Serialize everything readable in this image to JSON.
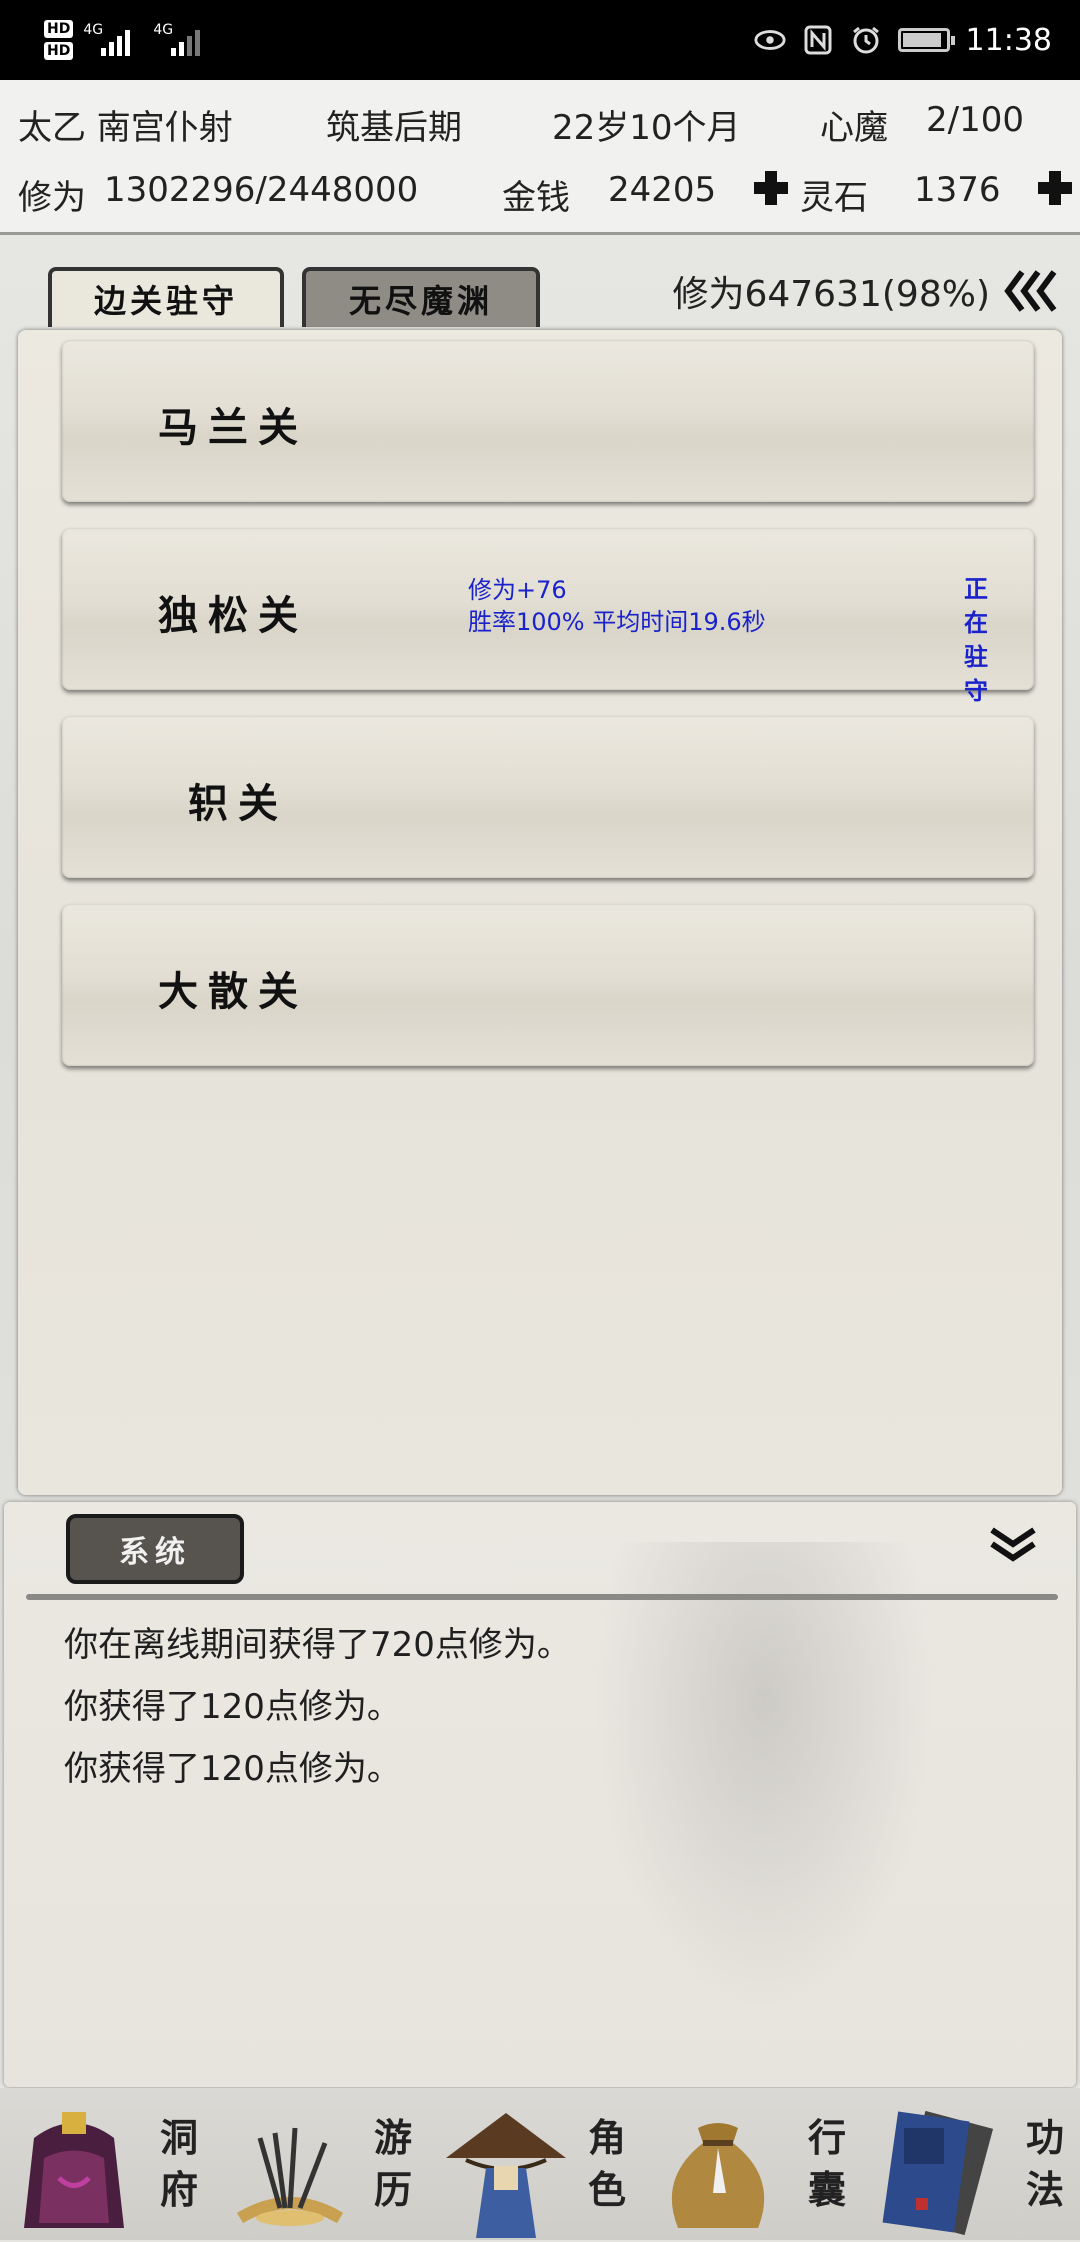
{
  "status_bar": {
    "time": "11:38",
    "sim_labels": [
      "HD",
      "HD"
    ],
    "network": [
      "4G",
      "4G"
    ],
    "icons": [
      "eye-icon",
      "nfc-icon",
      "alarm-icon",
      "battery-icon"
    ]
  },
  "player": {
    "name": "太乙 南宫仆射",
    "realm": "筑基后期",
    "age": "22岁10个月",
    "heart_demon_label": "心魔",
    "heart_demon_value": "2/100",
    "cultivation_label": "修为",
    "cultivation_value": "1302296/2448000",
    "money_label": "金钱",
    "money_value": "24205",
    "spirit_stone_label": "灵石",
    "spirit_stone_value": "1376"
  },
  "tabs": [
    {
      "label": "边关驻守",
      "active": true
    },
    {
      "label": "无尽魔渊",
      "active": false
    }
  ],
  "cultivation_progress": "修为647631(98%)",
  "passes": [
    {
      "name": "马兰关"
    },
    {
      "name": "独松关",
      "info_line1": "修为+76",
      "info_line2": "胜率100% 平均时间19.6秒",
      "status": "正在驻守"
    },
    {
      "name": "轵关"
    },
    {
      "name": "大散关"
    }
  ],
  "log": {
    "channel": "系统",
    "messages": [
      "你在离线期间获得了720点修为。",
      "你获得了120点修为。",
      "你获得了120点修为。"
    ]
  },
  "nav": [
    {
      "label": "洞府",
      "icon": "cave-dwelling-icon"
    },
    {
      "label": "游历",
      "icon": "travel-icon"
    },
    {
      "label": "角色",
      "icon": "character-icon"
    },
    {
      "label": "行囊",
      "icon": "bag-icon"
    },
    {
      "label": "功法",
      "icon": "manual-book-icon"
    }
  ],
  "colors": {
    "info_text": "#1a22cc",
    "tab_active": "#eae7dd",
    "tab_inactive": "#8f8c86",
    "status_bar": "#000000"
  }
}
